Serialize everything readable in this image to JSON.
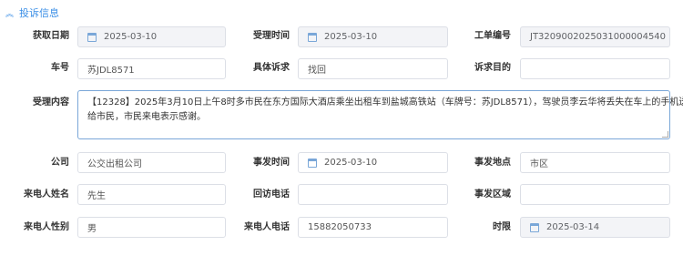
{
  "section": {
    "title": "投诉信息"
  },
  "labels": {
    "fetch_date": "获取日期",
    "accept_time": "受理时间",
    "work_order_no": "工单编号",
    "car_no": "车号",
    "specific_appeal": "具体诉求",
    "appeal_purpose": "诉求目的",
    "accept_content": "受理内容",
    "company": "公司",
    "incident_time": "事发时间",
    "incident_place": "事发地点",
    "caller_name": "来电人姓名",
    "callback_phone": "回访电话",
    "incident_area": "事发区域",
    "caller_gender": "来电人性别",
    "caller_phone": "来电人电话",
    "time_limit": "时限"
  },
  "values": {
    "fetch_date": "2025-03-10",
    "accept_time": "2025-03-10",
    "work_order_no": "JT3209002025031000004540",
    "car_no": "苏JDL8571",
    "specific_appeal": "找回",
    "appeal_purpose": "",
    "accept_content_line1": "【12328】2025年3月10日上午8时多市民在东方国际大酒店乘坐出租车到盐城高铁站（车牌号：苏JDL8571），驾驶员李云华将丢失在车上的手机送还",
    "accept_content_line2": "给市民，市民来电表示感谢。",
    "company": "公交出租公司",
    "incident_time": "2025-03-10",
    "incident_place": "市区",
    "caller_name": "先生",
    "callback_phone": "",
    "incident_area": "",
    "caller_gender": "男",
    "caller_phone": "15882050733",
    "time_limit": "2025-03-14"
  }
}
